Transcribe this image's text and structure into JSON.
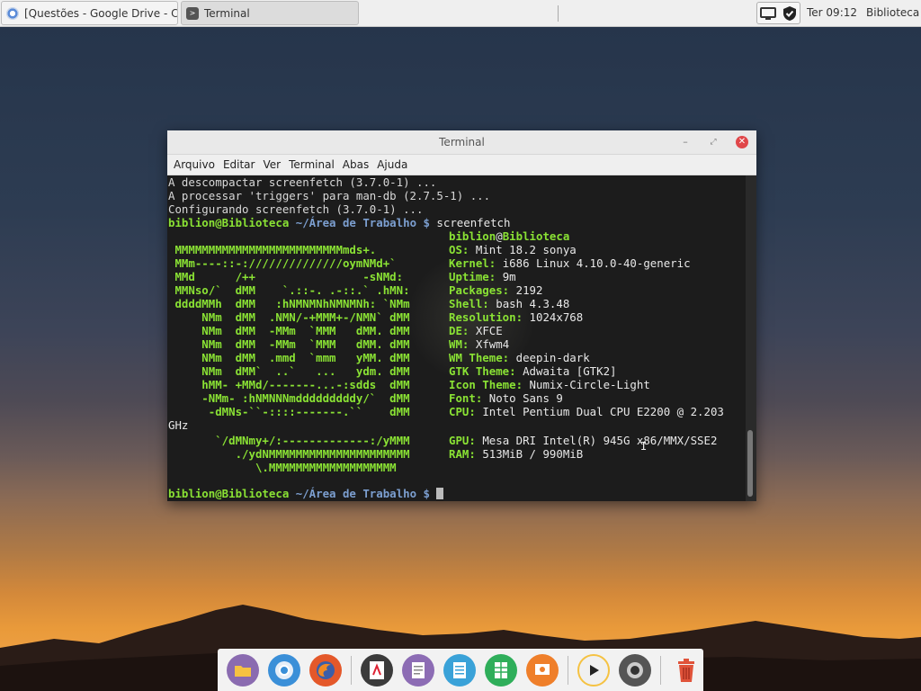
{
  "panel": {
    "tasks": [
      {
        "label": "[Questões - Google Drive - C...",
        "icon": "chrome-icon"
      },
      {
        "label": "Terminal",
        "icon": "terminal-icon"
      }
    ],
    "clock": "Ter 09:12",
    "user": "Biblioteca",
    "tray_icons": [
      "network-icon",
      "shield-icon"
    ]
  },
  "window": {
    "title": "Terminal",
    "menu": [
      "Arquivo",
      "Editar",
      "Ver",
      "Terminal",
      "Abas",
      "Ajuda"
    ]
  },
  "terminal": {
    "pre_lines": [
      "A descompactar screenfetch (3.7.0-1) ...",
      "A processar 'triggers' para man-db (2.7.5-1) ...",
      "Configurando screenfetch (3.7.0-1) ..."
    ],
    "prompt_user": "biblion@Biblioteca",
    "prompt_path": "~/Área de Trabalho $",
    "command": "screenfetch",
    "ascii": [
      " MMMMMMMMMMMMMMMMMMMMMMMMMmds+.      ",
      " MMm----::-://////////////oymNMd+`    ",
      " MMd      /++                -sNMd:   ",
      " MMNso/`  dMM    `.::-. .-::.` .hMN:  ",
      " ddddMMh  dMM   :hNMNMNhNMNMNh: `NMm  ",
      "     NMm  dMM  .NMN/-+MMM+-/NMN` dMM  ",
      "     NMm  dMM  -MMm  `MMM   dMM. dMM  ",
      "     NMm  dMM  -MMm  `MMM   dMM. dMM  ",
      "     NMm  dMM  .mmd  `mmm   yMM. dMM  ",
      "     NMm  dMM`  ..`   ...   ydm. dMM  ",
      "     hMM- +MMd/-------...-:sdds  dMM  ",
      "     -NMm- :hNMNNNmdddddddddy/`  dMM  ",
      "      -dMNs-``-::::-------.``    dMM  ",
      "       `/dMNmy+/:-------------:/yMMM  ",
      "          ./ydNMMMMMMMMMMMMMMMMMMMMM  ",
      "             \\.MMMMMMMMMMMMMMMMMMM    "
    ],
    "sysinfo_user": "biblion",
    "sysinfo_host": "Biblioteca",
    "info": [
      {
        "key": "OS:",
        "value": "Mint 18.2 sonya"
      },
      {
        "key": "Kernel:",
        "value": "i686 Linux 4.10.0-40-generic"
      },
      {
        "key": "Uptime:",
        "value": "9m"
      },
      {
        "key": "Packages:",
        "value": "2192"
      },
      {
        "key": "Shell:",
        "value": "bash 4.3.48"
      },
      {
        "key": "Resolution:",
        "value": "1024x768"
      },
      {
        "key": "DE:",
        "value": "XFCE"
      },
      {
        "key": "WM:",
        "value": "Xfwm4"
      },
      {
        "key": "WM Theme:",
        "value": "deepin-dark"
      },
      {
        "key": "GTK Theme:",
        "value": "Adwaita [GTK2]"
      },
      {
        "key": "Icon Theme:",
        "value": "Numix-Circle-Light"
      },
      {
        "key": "Font:",
        "value": "Noto Sans 9"
      },
      {
        "key": "CPU:",
        "value": "Intel Pentium Dual CPU E2200 @ 2.203"
      },
      {
        "key": "GPU:",
        "value": "Mesa DRI Intel(R) 945G x86/MMX/SSE2"
      },
      {
        "key": "RAM:",
        "value": "513MiB / 990MiB"
      }
    ],
    "cpu_wrap": "GHz"
  },
  "dock": {
    "apps": [
      "files-icon",
      "chromium-icon",
      "firefox-icon",
      "pdf-viewer-icon",
      "text-editor-icon",
      "document-icon",
      "spreadsheet-icon",
      "presentation-icon",
      "media-player-icon",
      "screenshot-icon",
      "trash-icon"
    ]
  },
  "colors": {
    "prompt_green": "#8ae234",
    "prompt_blue": "#7c9fd0",
    "close_red": "#e0474a"
  }
}
